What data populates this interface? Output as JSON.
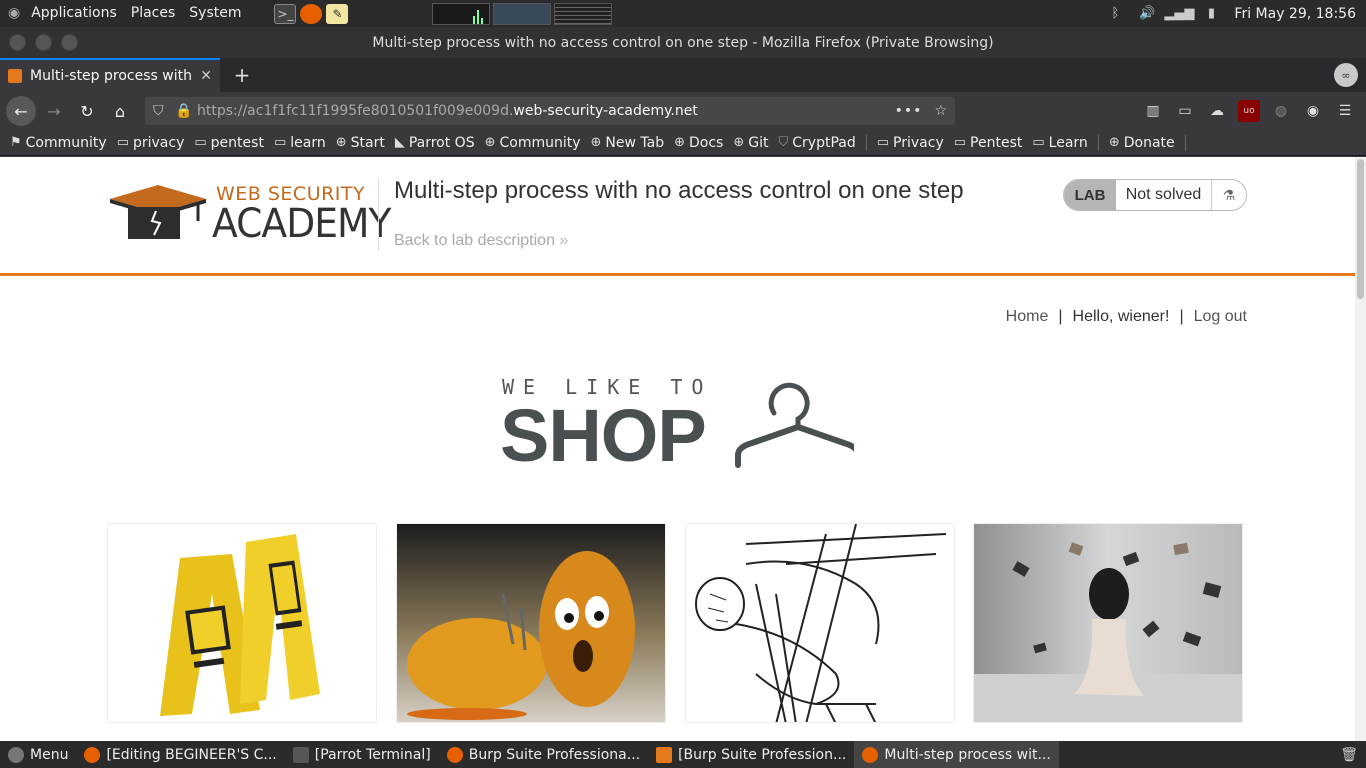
{
  "top_panel": {
    "menus": [
      "Applications",
      "Places",
      "System"
    ],
    "clock": "Fri May 29, 18:56"
  },
  "window": {
    "title": "Multi-step process with no access control on one step - Mozilla Firefox (Private Browsing)"
  },
  "tab": {
    "title": "Multi-step process with n",
    "close": "✕",
    "new_tab": "+"
  },
  "urlbar": {
    "prefix": "https://ac1f1fc11f1995fe8010501f009e009d.",
    "domain": "web-security-academy.net",
    "page_actions": "•••",
    "star": "☆"
  },
  "bookmarks": [
    {
      "icon": "community-icon",
      "label": "Community"
    },
    {
      "icon": "folder-icon",
      "label": "privacy"
    },
    {
      "icon": "folder-icon",
      "label": "pentest"
    },
    {
      "icon": "folder-icon",
      "label": "learn"
    },
    {
      "icon": "globe-icon",
      "label": "Start"
    },
    {
      "icon": "parrot-icon",
      "label": "Parrot OS"
    },
    {
      "icon": "globe-icon",
      "label": "Community"
    },
    {
      "icon": "globe-icon",
      "label": "New Tab"
    },
    {
      "icon": "globe-icon",
      "label": "Docs"
    },
    {
      "icon": "globe-icon",
      "label": "Git"
    },
    {
      "icon": "shield-icon",
      "label": "CryptPad"
    },
    {
      "icon": "folder-icon",
      "label": "Privacy"
    },
    {
      "icon": "folder-icon",
      "label": "Pentest"
    },
    {
      "icon": "folder-icon",
      "label": "Learn"
    },
    {
      "icon": "globe-icon",
      "label": "Donate"
    }
  ],
  "academy": {
    "logo_top": "WEB SECURITY",
    "logo_bottom": "ACADEMY",
    "lab_title": "Multi-step process with no access control on one step",
    "back_link": "Back to lab description",
    "back_chevron": "»",
    "lab_badge": "LAB",
    "lab_status": "Not solved",
    "accent": "#e47a1d"
  },
  "shop": {
    "nav": {
      "home": "Home",
      "separator": "|",
      "greeting": "Hello, wiener!",
      "logout": "Log out"
    },
    "logo_line1": "WE LIKE TO",
    "logo_line2": "SHOP"
  },
  "products": [
    {
      "name": "caution-signs-product"
    },
    {
      "name": "potatoes-product"
    },
    {
      "name": "sketch-product"
    },
    {
      "name": "flying-books-product"
    }
  ],
  "taskbar": [
    {
      "label": "Menu"
    },
    {
      "label": "[Editing BEGINEER'S C..."
    },
    {
      "label": "[Parrot Terminal]"
    },
    {
      "label": "Burp Suite Professiona..."
    },
    {
      "label": "[Burp Suite Profession..."
    },
    {
      "label": "Multi-step process wit..."
    }
  ]
}
